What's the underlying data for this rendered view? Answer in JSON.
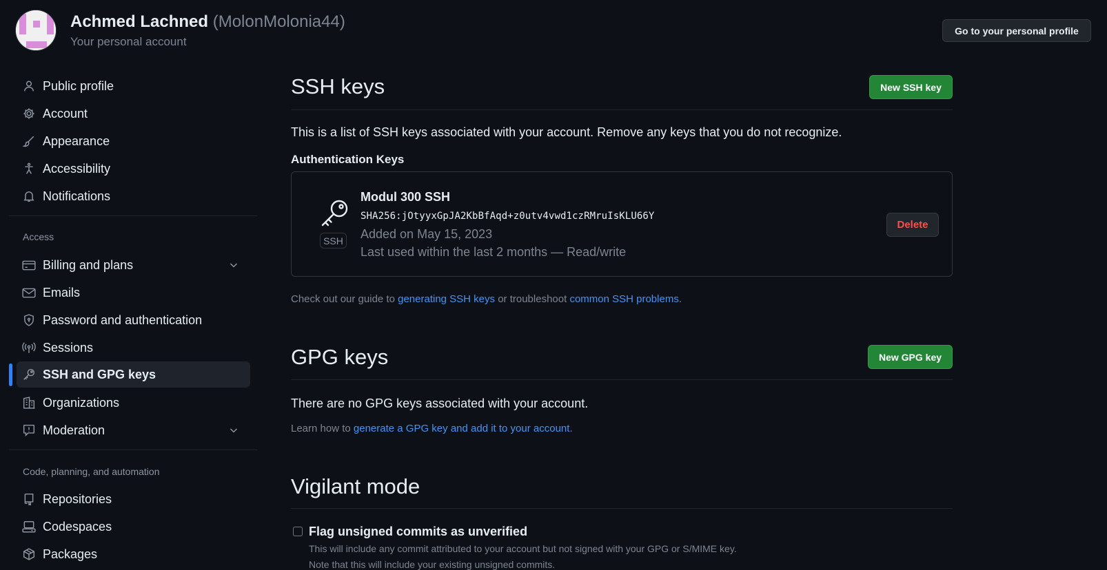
{
  "header": {
    "user_name": "Achmed Lachned",
    "user_handle": "(MolonMolonia44)",
    "subtitle": "Your personal account",
    "profile_button": "Go to your personal profile"
  },
  "sidebar": {
    "items_top": [
      {
        "label": "Public profile",
        "icon": "person-icon"
      },
      {
        "label": "Account",
        "icon": "gear-icon"
      },
      {
        "label": "Appearance",
        "icon": "paintbrush-icon"
      },
      {
        "label": "Accessibility",
        "icon": "accessibility-icon"
      },
      {
        "label": "Notifications",
        "icon": "bell-icon"
      }
    ],
    "access_label": "Access",
    "items_access": [
      {
        "label": "Billing and plans",
        "icon": "credit-card-icon"
      },
      {
        "label": "Emails",
        "icon": "mail-icon"
      },
      {
        "label": "Password and authentication",
        "icon": "shield-icon"
      },
      {
        "label": "Sessions",
        "icon": "broadcast-icon"
      },
      {
        "label": "SSH and GPG keys",
        "icon": "key-icon",
        "active": true
      },
      {
        "label": "Organizations",
        "icon": "organization-icon"
      },
      {
        "label": "Moderation",
        "icon": "report-icon"
      }
    ],
    "code_label": "Code, planning, and automation",
    "items_code": [
      {
        "label": "Repositories",
        "icon": "repo-icon"
      },
      {
        "label": "Codespaces",
        "icon": "codespaces-icon"
      },
      {
        "label": "Packages",
        "icon": "package-icon"
      }
    ]
  },
  "ssh": {
    "title": "SSH keys",
    "new_button": "New SSH key",
    "description": "This is a list of SSH keys associated with your account. Remove any keys that you do not recognize.",
    "auth_heading": "Authentication Keys",
    "key": {
      "badge": "SSH",
      "name": "Modul 300 SSH",
      "fingerprint": "SHA256:jOtyyxGpJA2KbBfAqd+z0utv4vwd1czRMruIsKLU66Y",
      "added": "Added on May 15, 2023",
      "last_used": "Last used within the last 2 months — Read/write",
      "delete_button": "Delete"
    },
    "guide_prefix": "Check out our guide to ",
    "guide_link1": "generating SSH keys",
    "guide_middle": " or troubleshoot ",
    "guide_link2": "common SSH problems",
    "guide_suffix": "."
  },
  "gpg": {
    "title": "GPG keys",
    "new_button": "New GPG key",
    "empty": "There are no GPG keys associated with your account.",
    "learn_prefix": "Learn how to ",
    "learn_link": "generate a GPG key and add it to your account",
    "learn_suffix": "."
  },
  "vigilant": {
    "title": "Vigilant mode",
    "checkbox_label": "Flag unsigned commits as unverified",
    "checked": false,
    "note1": "This will include any commit attributed to your account but not signed with your GPG or S/MIME key.",
    "note2": "Note that this will include your existing unsigned commits."
  },
  "colors": {
    "background": "#0d1117",
    "accent_blue": "#2f81f7",
    "green_button": "#238636",
    "danger": "#f85149",
    "avatar_pink": "#d98ed9"
  }
}
